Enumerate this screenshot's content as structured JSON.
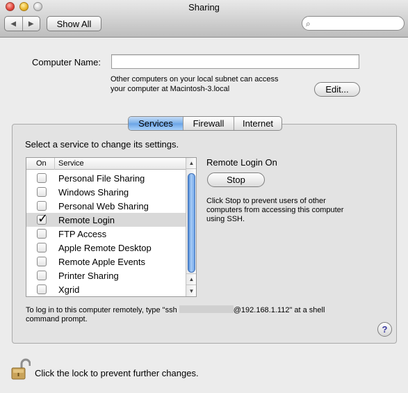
{
  "window": {
    "title": "Sharing"
  },
  "toolbar": {
    "back_icon": "left-arrow-icon",
    "forward_icon": "right-arrow-icon",
    "show_all_label": "Show All",
    "search_placeholder": "",
    "search_icon": "magnifier-icon"
  },
  "computer_name": {
    "label": "Computer Name:",
    "value": "",
    "note_line1": "Other computers on your local subnet can access",
    "note_line2": "your computer at Macintosh-3.local",
    "edit_label": "Edit..."
  },
  "tabs": [
    {
      "label": "Services",
      "active": true
    },
    {
      "label": "Firewall",
      "active": false
    },
    {
      "label": "Internet",
      "active": false
    }
  ],
  "services": {
    "hint": "Select a service to change its settings.",
    "col_on": "On",
    "col_service": "Service",
    "items": [
      {
        "name": "Personal File Sharing",
        "on": false,
        "selected": false
      },
      {
        "name": "Windows Sharing",
        "on": false,
        "selected": false
      },
      {
        "name": "Personal Web Sharing",
        "on": false,
        "selected": false
      },
      {
        "name": "Remote Login",
        "on": true,
        "selected": true
      },
      {
        "name": "FTP Access",
        "on": false,
        "selected": false
      },
      {
        "name": "Apple Remote Desktop",
        "on": false,
        "selected": false
      },
      {
        "name": "Remote Apple Events",
        "on": false,
        "selected": false
      },
      {
        "name": "Printer Sharing",
        "on": false,
        "selected": false
      },
      {
        "name": "Xgrid",
        "on": false,
        "selected": false
      }
    ]
  },
  "status": {
    "title": "Remote Login On",
    "button_label": "Stop",
    "desc_line1": "Click Stop to prevent users of other",
    "desc_line2": "computers from accessing this computer",
    "desc_line3": "using SSH."
  },
  "login_info": {
    "prefix": "To log in to this computer remotely, type \"ssh ",
    "suffix": "@192.168.1.112\" at a shell",
    "line2": "command prompt."
  },
  "help_label": "?",
  "lock": {
    "icon": "unlocked-padlock-icon",
    "text": "Click the lock to prevent further changes."
  }
}
